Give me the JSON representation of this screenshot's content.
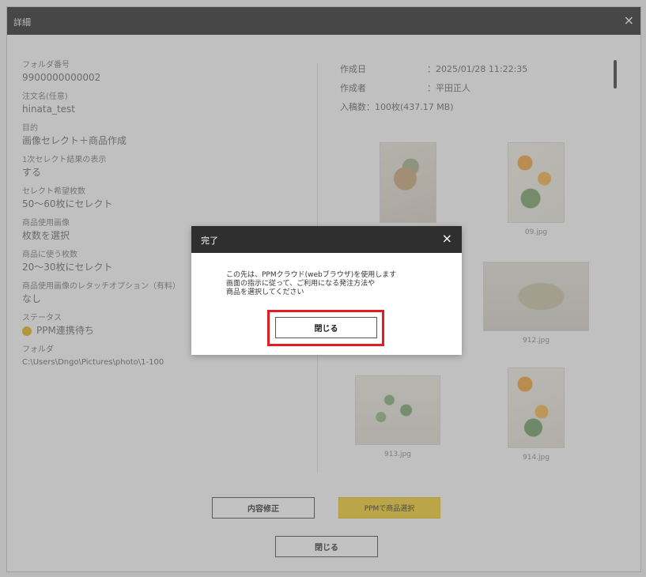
{
  "window": {
    "title": "詳細",
    "close_glyph": "×"
  },
  "left": {
    "fields": [
      {
        "label": "フォルダ番号",
        "value": "9900000000002"
      },
      {
        "label": "注文名(任意)",
        "value": "hinata_test"
      },
      {
        "label": "目的",
        "value": "画像セレクト＋商品作成"
      },
      {
        "label": "1次セレクト結果の表示",
        "value": "する"
      },
      {
        "label": "セレクト希望枚数",
        "value": "50〜60枚にセレクト"
      },
      {
        "label": "商品使用画像",
        "value": "枚数を選択"
      },
      {
        "label": "商品に使う枚数",
        "value": "20〜30枚にセレクト"
      },
      {
        "label": "商品使用画像のレタッチオプション（有料）",
        "value": "なし"
      }
    ],
    "status": {
      "label": "ステータス",
      "value": "PPM連携待ち",
      "color": "#e6b21d"
    },
    "folder": {
      "label": "フォルダ",
      "value": "C:\\Users\\Dngo\\Pictures\\photo\\1-100"
    }
  },
  "right": {
    "meta": [
      {
        "key": "作成日",
        "value": "：2025/01/28 11:22:35"
      },
      {
        "key": "作成者",
        "value": "：平田正人"
      },
      {
        "key": "入稿数：100枚(437.17 MB)",
        "value": ""
      }
    ],
    "thumbnails": [
      {
        "name": ""
      },
      {
        "name": "09.jpg"
      },
      {
        "name": "912.jpg"
      },
      {
        "name": "913.jpg"
      },
      {
        "name": "914.jpg"
      }
    ]
  },
  "footer": {
    "detail_button": "内容修正",
    "ppm_button": "PPMで商品選択",
    "close_button": "閉じる"
  },
  "modal": {
    "title": "完了",
    "close_glyph": "×",
    "lines": [
      "この先は、PPMクラウド(webブラウザ)を使用します",
      "画面の指示に従って、ご利用になる発注方法や",
      "商品を選択してください"
    ],
    "close_button": "閉じる",
    "highlight_color": "#e41e20"
  }
}
